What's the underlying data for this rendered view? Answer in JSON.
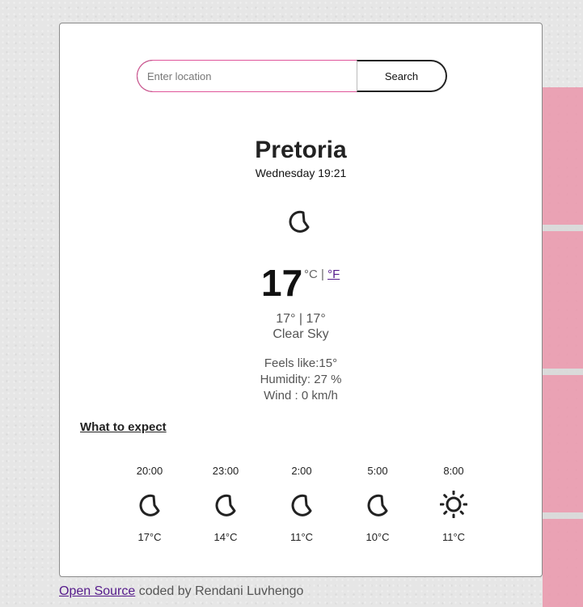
{
  "search": {
    "placeholder": "Enter location",
    "button_label": "Search"
  },
  "current": {
    "city": "Pretoria",
    "datetime": "Wednesday 19:21",
    "icon": "moon-crescent-icon",
    "temperature": "17",
    "unit_celsius": "°C",
    "unit_separator": " | ",
    "unit_fahrenheit": "°F",
    "min_max": "17° | 17°",
    "description": "Clear Sky",
    "feels_like": "Feels like:15°",
    "humidity": "Humidity: 27 %",
    "wind": "Wind : 0 km/h"
  },
  "forecast_heading": "What to expect",
  "forecast": [
    {
      "time": "20:00",
      "icon": "moon-crescent-icon",
      "temp": "17°C"
    },
    {
      "time": "23:00",
      "icon": "moon-crescent-icon",
      "temp": "14°C"
    },
    {
      "time": "2:00",
      "icon": "moon-crescent-icon",
      "temp": "11°C"
    },
    {
      "time": "5:00",
      "icon": "moon-crescent-icon",
      "temp": "10°C"
    },
    {
      "time": "8:00",
      "icon": "sun-icon",
      "temp": "11°C"
    }
  ],
  "footer": {
    "link_text": "Open Source",
    "text": " coded by Rendani Luvhengo"
  },
  "colors": {
    "input_focus": "#e0559a",
    "link": "#551a8b",
    "pink_decor": "#ea9aae"
  }
}
